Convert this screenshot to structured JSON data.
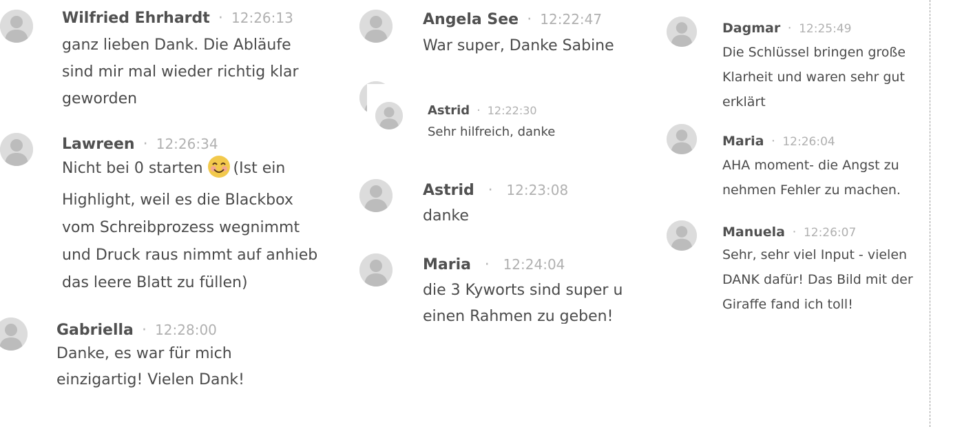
{
  "messages": [
    {
      "name": "Wilfried Ehrhardt",
      "time": "12:26:13",
      "lines": [
        "ganz lieben Dank. Die Abläufe",
        "sind mir mal wieder richtig klar",
        "geworden"
      ]
    },
    {
      "name": "Lawreen",
      "time": "12:26:34",
      "lines": [
        "Nicht bei 0 starten",
        "(Ist ein",
        "Highlight, weil es die Blackbox",
        "vom Schreibprozess wegnimmt",
        "und Druck raus nimmt auf anhieb",
        "das leere Blatt zu füllen)"
      ],
      "emoji": "smiling-face-emoji"
    },
    {
      "name": "Gabriella",
      "time": "12:28:00",
      "lines": [
        "Danke, es war für mich",
        "einzigartig!  Vielen Dank!"
      ]
    },
    {
      "name": "Angela See",
      "time": "12:22:47",
      "lines": [
        "War super, Danke Sabine"
      ]
    },
    {
      "name": "Astrid",
      "time": "12:22:30",
      "lines": [
        "Sehr hilfreich, danke"
      ]
    },
    {
      "name": "Astrid",
      "time": "12:23:08",
      "lines": [
        "danke"
      ]
    },
    {
      "name": "Maria",
      "time": "12:24:04",
      "lines": [
        "die 3 Kyworts sind super u",
        "einen Rahmen zu geben!"
      ]
    },
    {
      "name": "Dagmar",
      "time": "12:25:49",
      "lines": [
        "Die Schlüssel bringen große",
        "Klarheit und waren sehr gut",
        "erklärt"
      ]
    },
    {
      "name": "Maria",
      "time": "12:26:04",
      "lines": [
        "AHA moment- die Angst zu",
        "nehmen Fehler zu machen."
      ]
    },
    {
      "name": "Manuela",
      "time": "12:26:07",
      "lines": [
        "Sehr, sehr viel Input - vielen",
        "DANK dafür! Das Bild mit der",
        "Giraffe fand ich toll!"
      ]
    }
  ],
  "icons": {
    "avatar": "user-avatar-icon",
    "emoji": "smiling-face-emoji"
  },
  "colors": {
    "name": "#505050",
    "time": "#b0b0b0",
    "body": "#4a4a4a",
    "avatar_bg": "#dcdcdc",
    "avatar_fg": "#bcbcbc",
    "emoji": "#f2c94c"
  }
}
